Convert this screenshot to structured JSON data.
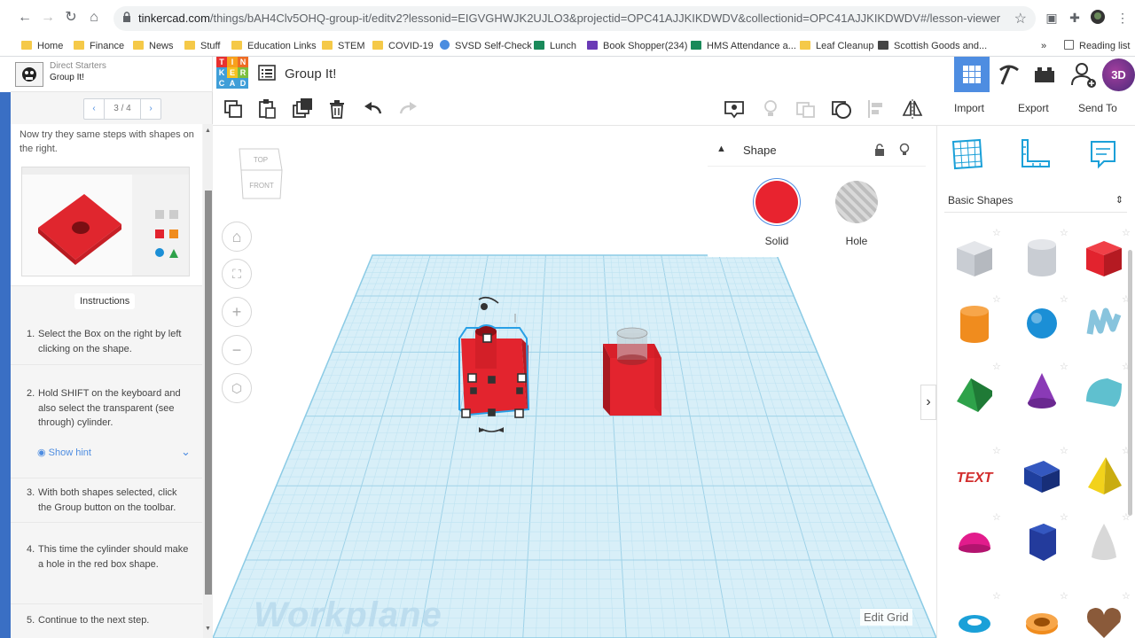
{
  "browser": {
    "url_host": "tinkercad.com",
    "url_path": "/things/bAH4Clv5OHQ-group-it/editv2?lessonid=EIGVGHWJK2UJLO3&projectid=OPC41AJJKIKDWDV&collectionid=OPC41AJJKIKDWDV#/lesson-viewer",
    "bookmarks": [
      {
        "label": "Home",
        "icon": "folder-icon"
      },
      {
        "label": "Finance",
        "icon": "folder-icon"
      },
      {
        "label": "News",
        "icon": "folder-icon"
      },
      {
        "label": "Stuff",
        "icon": "folder-icon"
      },
      {
        "label": "Education Links",
        "icon": "folder-icon"
      },
      {
        "label": "STEM",
        "icon": "folder-icon"
      },
      {
        "label": "COVID-19",
        "icon": "folder-icon"
      },
      {
        "label": "SVSD Self-Check",
        "icon": "globe-icon"
      },
      {
        "label": "Lunch",
        "icon": "sheets-icon"
      },
      {
        "label": "Book Shopper(234)",
        "icon": "forms-icon"
      },
      {
        "label": "HMS Attendance a...",
        "icon": "sheets-icon"
      },
      {
        "label": "Leaf Cleanup",
        "icon": "folder-icon"
      },
      {
        "label": "Scottish Goods and...",
        "icon": "cube-icon"
      }
    ],
    "more_label": "»",
    "reading_list": "Reading list"
  },
  "app": {
    "lesson_subtitle": "Direct Starters",
    "lesson_title": "Group It!",
    "logo_letters": [
      "T",
      "I",
      "N",
      "K",
      "E",
      "R",
      "C",
      "A",
      "D"
    ],
    "design_title": "Group It!",
    "avatar_text": "3D"
  },
  "lesson": {
    "pager": "3 / 4",
    "intro": "Now try they same steps with shapes on the right.",
    "instructions_tab": "Instructions",
    "steps": [
      {
        "num": "1.",
        "text": "Select the Box on the right by left clicking on the shape."
      },
      {
        "num": "2.",
        "text": "Hold SHIFT on the keyboard and also select the transparent (see through) cylinder."
      },
      {
        "num": "3.",
        "text": "With both shapes selected, click the Group button on the toolbar."
      },
      {
        "num": "4.",
        "text": "This time the cylinder should make a hole in the red box shape."
      },
      {
        "num": "5.",
        "text": "Continue to the next step."
      }
    ],
    "hint": "Show hint"
  },
  "toolbar": {
    "import": "Import",
    "export": "Export",
    "send_to": "Send To"
  },
  "viewcube": {
    "top": "TOP",
    "front": "FRONT"
  },
  "inspector": {
    "title": "Shape",
    "solid": "Solid",
    "hole": "Hole",
    "solid_color": "#e8232f"
  },
  "workplane": {
    "label": "Workplane",
    "edit_grid": "Edit Grid",
    "grid_color": "#bfe3f2"
  },
  "shapes_panel": {
    "category": "Basic Shapes",
    "shapes": [
      {
        "name": "box-hole",
        "color": "#c9cdd3"
      },
      {
        "name": "cylinder-hole",
        "color": "#c9cdd3"
      },
      {
        "name": "box",
        "color": "#e2232e"
      },
      {
        "name": "cylinder",
        "color": "#f08c1e"
      },
      {
        "name": "sphere",
        "color": "#1b8fd6"
      },
      {
        "name": "scribble",
        "color": "#88c4dd"
      },
      {
        "name": "roof",
        "color": "#2ea24a"
      },
      {
        "name": "cone",
        "color": "#8a3ab6"
      },
      {
        "name": "round-roof",
        "color": "#5fc0cf"
      },
      {
        "name": "text",
        "color": "#d22d2d"
      },
      {
        "name": "box-blue",
        "color": "#1f3f9e"
      },
      {
        "name": "pyramid",
        "color": "#f2d21b"
      },
      {
        "name": "half-sphere",
        "color": "#e21c8c"
      },
      {
        "name": "polygon",
        "color": "#233b9c"
      },
      {
        "name": "paraboloid",
        "color": "#d8d8d8"
      },
      {
        "name": "torus",
        "color": "#1ba0d8"
      },
      {
        "name": "tube",
        "color": "#f08c1e"
      },
      {
        "name": "heart",
        "color": "#8a5a3a"
      }
    ]
  }
}
